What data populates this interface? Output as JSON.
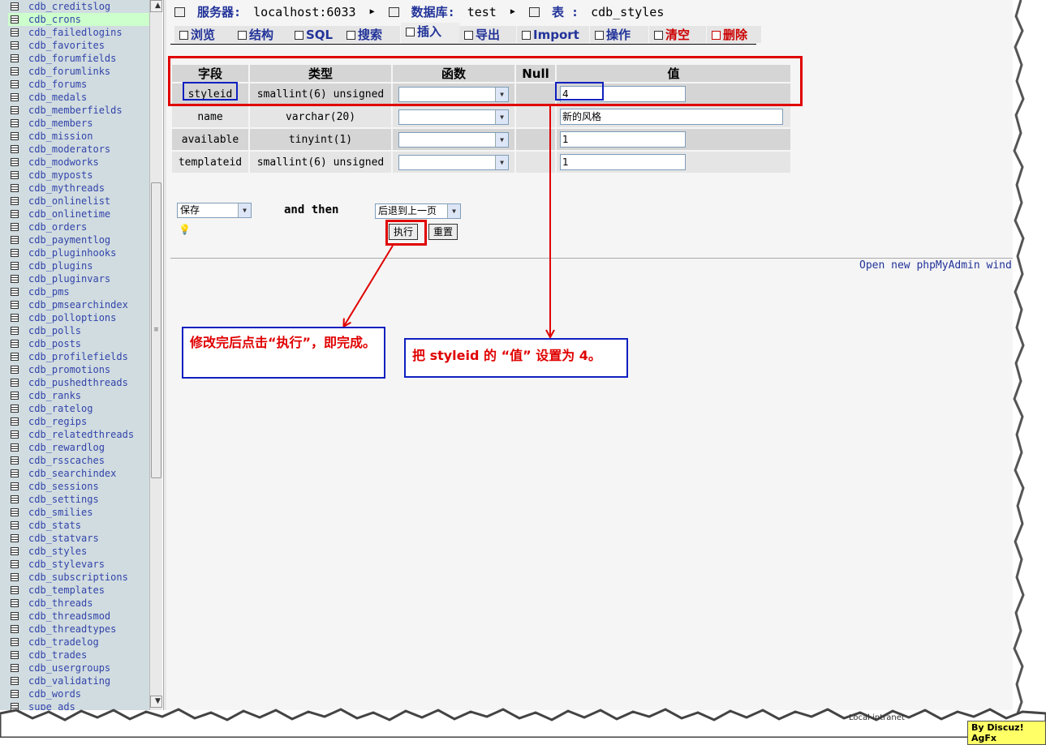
{
  "sidebar": {
    "tables": [
      "cdb_creditslog",
      "cdb_crons",
      "cdb_failedlogins",
      "cdb_favorites",
      "cdb_forumfields",
      "cdb_forumlinks",
      "cdb_forums",
      "cdb_medals",
      "cdb_memberfields",
      "cdb_members",
      "cdb_mission",
      "cdb_moderators",
      "cdb_modworks",
      "cdb_myposts",
      "cdb_mythreads",
      "cdb_onlinelist",
      "cdb_onlinetime",
      "cdb_orders",
      "cdb_paymentlog",
      "cdb_pluginhooks",
      "cdb_plugins",
      "cdb_pluginvars",
      "cdb_pms",
      "cdb_pmsearchindex",
      "cdb_polloptions",
      "cdb_polls",
      "cdb_posts",
      "cdb_profilefields",
      "cdb_promotions",
      "cdb_pushedthreads",
      "cdb_ranks",
      "cdb_ratelog",
      "cdb_regips",
      "cdb_relatedthreads",
      "cdb_rewardlog",
      "cdb_rsscaches",
      "cdb_searchindex",
      "cdb_sessions",
      "cdb_settings",
      "cdb_smilies",
      "cdb_stats",
      "cdb_statvars",
      "cdb_styles",
      "cdb_stylevars",
      "cdb_subscriptions",
      "cdb_templates",
      "cdb_threads",
      "cdb_threadsmod",
      "cdb_threadtypes",
      "cdb_tradelog",
      "cdb_trades",
      "cdb_usergroups",
      "cdb_validating",
      "cdb_words",
      "supe_ads"
    ],
    "active": "cdb_crons"
  },
  "breadcrumb": {
    "server_label": "服务器:",
    "server_value": "localhost:6033",
    "db_label": "数据库:",
    "db_value": "test",
    "table_label": "表 :",
    "table_value": "cdb_styles"
  },
  "tabs": [
    "浏览",
    "结构",
    "SQL",
    "搜索",
    "插入",
    "导出",
    "Import",
    "操作",
    "清空",
    "删除"
  ],
  "active_tab": "插入",
  "field_table": {
    "headers": [
      "字段",
      "类型",
      "函数",
      "Null",
      "值"
    ],
    "rows": [
      {
        "field": "styleid",
        "type": "smallint(6) unsigned",
        "value": "4"
      },
      {
        "field": "name",
        "type": "varchar(20)",
        "value": "新的风格"
      },
      {
        "field": "available",
        "type": "tinyint(1)",
        "value": "1"
      },
      {
        "field": "templateid",
        "type": "smallint(6) unsigned",
        "value": "1"
      }
    ]
  },
  "action_select": "保存",
  "and_then": "and then",
  "goto_select": "后退到上一页",
  "buttons": {
    "go": "执行",
    "reset": "重置"
  },
  "new_window_link": "Open new phpMyAdmin wind",
  "annotations": {
    "note_left": "修改完后点击“执行”，即完成。",
    "note_right": "把 styleid 的 “值” 设置为 4。"
  },
  "status_text": "Local intranet",
  "byline": "By Discuz! AgFx",
  "colors": {
    "annotation_red": "#e00000",
    "annotation_blue": "#1020c0",
    "link_blue": "#223399",
    "sidebar_bg": "#d0dce0"
  }
}
